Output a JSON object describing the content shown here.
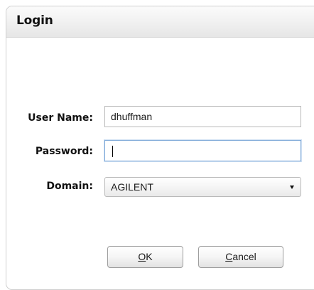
{
  "dialog": {
    "title": "Login"
  },
  "form": {
    "username": {
      "label": "User Name:",
      "value": "dhuffman"
    },
    "password": {
      "label": "Password:",
      "value": ""
    },
    "domain": {
      "label": "Domain:",
      "selected": "AGILENT",
      "arrow_icon": "dropdown-arrow-icon"
    }
  },
  "buttons": {
    "ok": {
      "mnemonic": "O",
      "rest": "K"
    },
    "cancel": {
      "mnemonic": "C",
      "rest": "ancel"
    }
  }
}
